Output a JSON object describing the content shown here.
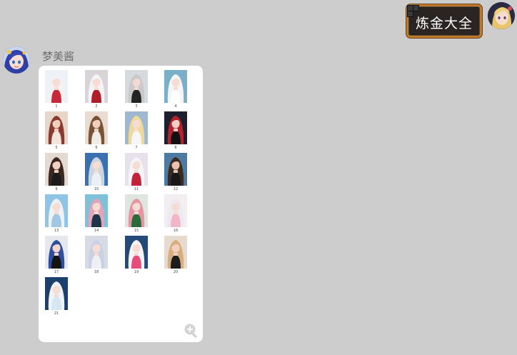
{
  "outgoing": {
    "text": "炼金大全"
  },
  "incoming": {
    "sender": "梦美酱",
    "thumbnails": [
      {
        "num": "1",
        "bg": "#eef1f5",
        "hair": "#f2f2f4",
        "outfit": "#c7283a",
        "skin": "#f6dcd2"
      },
      {
        "num": "2",
        "bg": "#d9d4d8",
        "hair": "#f4f4f6",
        "outfit": "#b01e2c",
        "skin": "#f6dcd2"
      },
      {
        "num": "3",
        "bg": "#d7dadd",
        "hair": "#c9c9cc",
        "outfit": "#232323",
        "skin": "#f3d9cf"
      },
      {
        "num": "4",
        "bg": "#79b0c8",
        "hair": "#f5f5f7",
        "outfit": "#ffffff",
        "skin": "#f6dcd2"
      },
      {
        "num": "5",
        "bg": "#e7d7cb",
        "hair": "#8a3a2f",
        "outfit": "#f2e6dc",
        "skin": "#f1d0c0"
      },
      {
        "num": "6",
        "bg": "#e9ddd3",
        "hair": "#7a5336",
        "outfit": "#f2ece6",
        "skin": "#f1d0c0"
      },
      {
        "num": "7",
        "bg": "#9fb8cf",
        "hair": "#efd99a",
        "outfit": "#f4f6f8",
        "skin": "#f6dcd2"
      },
      {
        "num": "8",
        "bg": "#1d1f2e",
        "hair": "#b3222c",
        "outfit": "#111111",
        "skin": "#f3d0c4"
      },
      {
        "num": "9",
        "bg": "#e4dad2",
        "hair": "#3b2620",
        "outfit": "#1b1b1b",
        "skin": "#f1d0c0"
      },
      {
        "num": "10",
        "bg": "#3a6fb0",
        "hair": "#c9d6e2",
        "outfit": "#eaf0f6",
        "skin": "#f6dcd2"
      },
      {
        "num": "11",
        "bg": "#e6e1ea",
        "hair": "#f5f5f7",
        "outfit": "#c4223a",
        "skin": "#f6dcd2"
      },
      {
        "num": "12",
        "bg": "#4d7aa0",
        "hair": "#3a2a22",
        "outfit": "#181818",
        "skin": "#e9c3ad"
      },
      {
        "num": "13",
        "bg": "#8fc4e6",
        "hair": "#eef2f6",
        "outfit": "#9fc8e4",
        "skin": "#f6dcd2"
      },
      {
        "num": "14",
        "bg": "#7ec1d9",
        "hair": "#e3a3bb",
        "outfit": "#1e3348",
        "skin": "#f6dcd2"
      },
      {
        "num": "15",
        "bg": "#dfe5df",
        "hair": "#e595a5",
        "outfit": "#2a6b3c",
        "skin": "#f6dcd2"
      },
      {
        "num": "16",
        "bg": "#f3eef1",
        "hair": "#eee9ee",
        "outfit": "#f2b6c9",
        "skin": "#f6dcd2"
      },
      {
        "num": "17",
        "bg": "#e6e8ee",
        "hair": "#2d4f9e",
        "outfit": "#141414",
        "skin": "#f3d6cb"
      },
      {
        "num": "18",
        "bg": "#d6dbe6",
        "hair": "#c9d1e2",
        "outfit": "#eef0f5",
        "skin": "#f6dcd2"
      },
      {
        "num": "19",
        "bg": "#244a7a",
        "hair": "#f5f5f7",
        "outfit": "#e74d7a",
        "skin": "#f6dcd2"
      },
      {
        "num": "20",
        "bg": "#e7dbd0",
        "hair": "#d9ad7e",
        "outfit": "#1d1d1d",
        "skin": "#f1d0c0"
      },
      {
        "num": "21",
        "bg": "#1d3f6e",
        "hair": "#eef3f8",
        "outfit": "#d6e7f4",
        "skin": "#f6dcd2"
      }
    ],
    "zoom_icon": "zoom-in-icon"
  }
}
